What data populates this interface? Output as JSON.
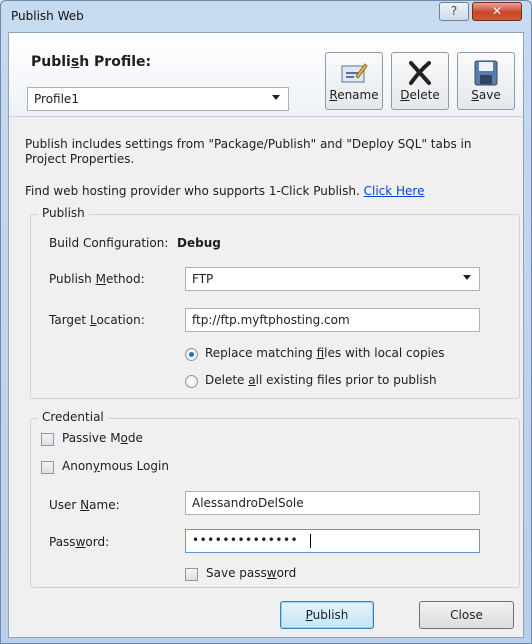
{
  "window": {
    "title": "Publish Web",
    "help_label": "?",
    "close_label": "✕"
  },
  "header": {
    "profile_label_pre": "Publi",
    "profile_label_mn": "s",
    "profile_label_post": "h Profile:",
    "profile_value": "Profile1",
    "rename_label_mn": "R",
    "rename_label_post": "ename",
    "delete_label_mn": "D",
    "delete_label_post": "elete",
    "save_label_mn": "S",
    "save_label_post": "ave"
  },
  "info": {
    "line1": "Publish includes settings from \"Package/Publish\" and \"Deploy SQL\" tabs in",
    "line2": "Project Properties.",
    "hosting_text": "Find web hosting provider who supports 1-Click Publish. ",
    "hosting_link": "Click Here"
  },
  "publish": {
    "legend": "Publish",
    "build_config_label": "Build Configuration:",
    "build_config_value": "Debug",
    "method_label_pre": "Publish ",
    "method_label_mn": "M",
    "method_label_post": "ethod:",
    "method_value": "FTP",
    "location_label_pre": "Target ",
    "location_label_mn": "L",
    "location_label_post": "ocation:",
    "location_value": "ftp://ftp.myftphosting.com",
    "radio1_pre": "Replace matching ",
    "radio1_mn": "f",
    "radio1_post": "iles with local copies",
    "radio2_pre": "Delete ",
    "radio2_mn": "a",
    "radio2_post": "ll existing files prior to publish"
  },
  "credential": {
    "legend": "Credential",
    "passive_pre": "Passive M",
    "passive_mn": "o",
    "passive_post": "de",
    "anon_pre": "Anon",
    "anon_mn": "y",
    "anon_post": "mous Login",
    "user_label_pre": "User ",
    "user_label_mn": "N",
    "user_label_post": "ame:",
    "user_value": "AlessandroDelSole",
    "password_label_pre": "Pass",
    "password_label_mn": "w",
    "password_label_post": "ord:",
    "password_value": "••••••••••••••",
    "save_pw_pre": "Save pass",
    "save_pw_mn": "w",
    "save_pw_post": "ord"
  },
  "footer": {
    "publish_mn": "P",
    "publish_post": "ublish",
    "close_label": "Close"
  }
}
